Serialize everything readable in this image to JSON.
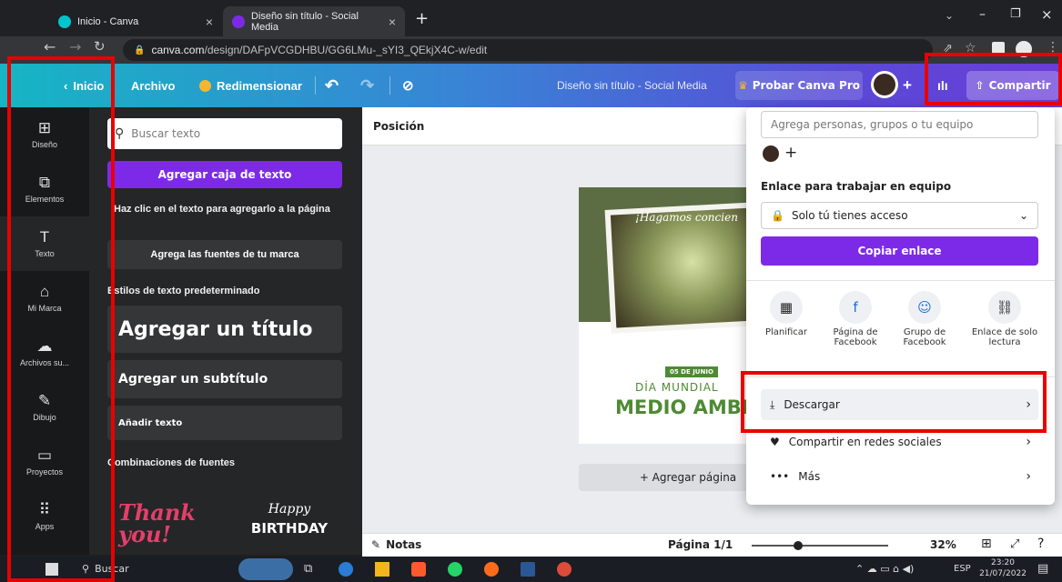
{
  "browser": {
    "tabs": [
      {
        "title": "Inicio - Canva",
        "favicon_color": "#00c4cc"
      },
      {
        "title": "Diseño sin título - Social Media",
        "favicon_color": "#7d2ae8"
      }
    ],
    "url_host": "canva.com",
    "url_path": "/design/DAFpVCGDHBU/GG6LMu-_sYI3_QEkjX4C-w/edit"
  },
  "header": {
    "home": "Inicio",
    "file": "Archivo",
    "resize": "Redimensionar",
    "doc_title": "Diseño sin título - Social Media",
    "try_pro": "Probar Canva Pro",
    "share": "Compartir",
    "accent": "#7d2ae8"
  },
  "rail": [
    {
      "label": "Diseño",
      "icon": "layout-icon"
    },
    {
      "label": "Elementos",
      "icon": "shapes-icon"
    },
    {
      "label": "Texto",
      "icon": "text-icon"
    },
    {
      "label": "Mi Marca",
      "icon": "brand-icon"
    },
    {
      "label": "Archivos su...",
      "icon": "upload-icon"
    },
    {
      "label": "Dibujo",
      "icon": "draw-icon"
    },
    {
      "label": "Proyectos",
      "icon": "folder-icon"
    },
    {
      "label": "Apps",
      "icon": "apps-icon"
    }
  ],
  "panel": {
    "search_placeholder": "Buscar texto",
    "add_textbox": "Agregar caja de texto",
    "hint": "Haz clic en el texto para agregarlo a la página",
    "brand_fonts": "Agrega las fuentes de tu marca",
    "defaults_heading": "Estilos de texto predeterminado",
    "add_title": "Agregar un título",
    "add_subtitle": "Agregar un subtítulo",
    "add_body": "Añadir texto",
    "combos_heading": "Combinaciones de fuentes",
    "combo1": "Thank you!",
    "combo2_script": "Happy",
    "combo2_bold": "BIRTHDAY"
  },
  "canvas": {
    "position": "Posición",
    "poster_script": "¡Hagamos concien",
    "poster_date": "05 DE JUNIO",
    "poster_day": "DÍA MUNDIAL",
    "poster_title": "MEDIO AMBI",
    "add_page": "+ Agregar página",
    "notes": "Notas",
    "page": "Página 1/1",
    "zoom": "32%"
  },
  "share": {
    "add_people_placeholder": "Agrega personas, grupos o tu equipo",
    "team_link_label": "Enlace para trabajar en equipo",
    "access": "Solo tú tienes acceso",
    "copy_link": "Copiar enlace",
    "options": [
      {
        "label": "Planificar",
        "icon": "calendar-icon"
      },
      {
        "label": "Página de Facebook",
        "icon": "facebook-icon"
      },
      {
        "label": "Grupo de Facebook",
        "icon": "facebook-group-icon"
      },
      {
        "label": "Enlace de solo lectura",
        "icon": "link-icon"
      }
    ],
    "download": "Descargar",
    "social": "Compartir en redes sociales",
    "more": "Más"
  },
  "taskbar": {
    "search": "Buscar",
    "lang": "ESP",
    "time": "23:20",
    "date": "21/07/2022"
  }
}
